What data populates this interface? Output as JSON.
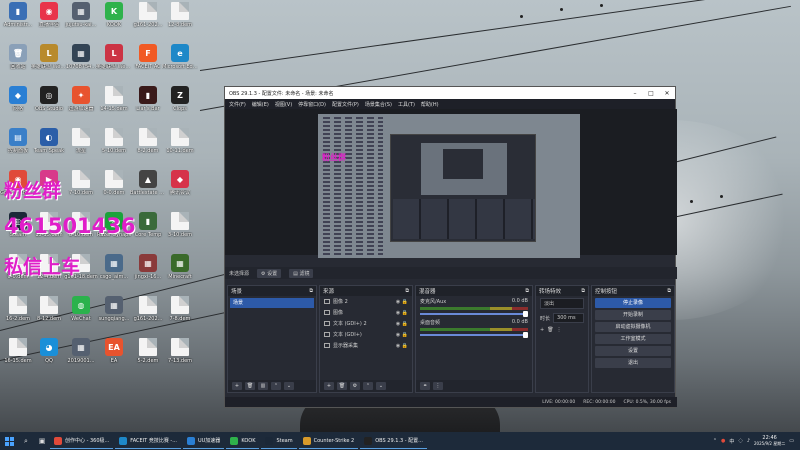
{
  "desktop": {
    "icons": [
      {
        "label": "Administr...",
        "color": "#3a6fb5",
        "glyph": "▮"
      },
      {
        "label": "直播伴侣",
        "color": "#e8344a",
        "glyph": "◉"
      },
      {
        "label": "jujutsu-kai...",
        "color": "#556070",
        "glyph": "▦"
      },
      {
        "label": "KOOK",
        "color": "#2fb24b",
        "glyph": "K"
      },
      {
        "label": "g161-202...",
        "color": "#eeeeee",
        "glyph": ""
      },
      {
        "label": "12-8.dem",
        "color": "#eeeeee",
        "glyph": ""
      },
      {
        "label": "回收站",
        "color": "#8aa0b8",
        "glyph": "🗑"
      },
      {
        "label": "英雄联盟 WeGame版",
        "color": "#b88a2c",
        "glyph": "L"
      },
      {
        "label": "10708754...",
        "color": "#334455",
        "glyph": "▦"
      },
      {
        "label": "英雄联盟 WeGame版",
        "color": "#cc3344",
        "glyph": "L"
      },
      {
        "label": "FACEIT AC",
        "color": "#f15a24",
        "glyph": "F"
      },
      {
        "label": "Microsoft Edge",
        "color": "#1e88c8",
        "glyph": "e"
      },
      {
        "label": "网络",
        "color": "#2a7fd4",
        "glyph": "◆"
      },
      {
        "label": "OBS Studio",
        "color": "#222222",
        "glyph": "◎"
      },
      {
        "label": "迅游加速器",
        "color": "#e8532e",
        "glyph": "✦"
      },
      {
        "label": "14-15.dem",
        "color": "#eeeeee",
        "glyph": ""
      },
      {
        "label": "Liar's Bar",
        "color": "#3a1a1a",
        "glyph": "▮"
      },
      {
        "label": "Clops",
        "color": "#222222",
        "glyph": "Z"
      },
      {
        "label": "控制面板",
        "color": "#3a7fc8",
        "glyph": "▤"
      },
      {
        "label": "Team Speak",
        "color": "#2b5ea8",
        "glyph": "◐"
      },
      {
        "label": "流星",
        "color": "#eeeeee",
        "glyph": ""
      },
      {
        "label": "5-10.dem",
        "color": "#eeeeee",
        "glyph": ""
      },
      {
        "label": "8-2.dem",
        "color": "#eeeeee",
        "glyph": ""
      },
      {
        "label": "10-11.dem",
        "color": "#eeeeee",
        "glyph": ""
      },
      {
        "label": "Google Chrome",
        "color": "#e04a3a",
        "glyph": "◉"
      },
      {
        "label": "uu",
        "color": "#d83a8a",
        "glyph": "▶"
      },
      {
        "label": "7-10.dem",
        "color": "#eeeeee",
        "glyph": ""
      },
      {
        "label": "0-0.dem",
        "color": "#eeeeee",
        "glyph": ""
      },
      {
        "label": "Battlestate Games L...",
        "color": "#444444",
        "glyph": "▲"
      },
      {
        "label": "腾讯会议",
        "color": "#d6334a",
        "glyph": "◆"
      },
      {
        "label": "Steam",
        "color": "#1b2838",
        "glyph": "◎"
      },
      {
        "label": "15-15.dem",
        "color": "#eeeeee",
        "glyph": ""
      },
      {
        "label": "8-10.dem",
        "color": "#eeeeee",
        "glyph": ""
      },
      {
        "label": "Razer Synaps",
        "color": "#1aa33a",
        "glyph": "✳"
      },
      {
        "label": "Core Temp",
        "color": "#3a6a3a",
        "glyph": "▮"
      },
      {
        "label": "3-10.dem",
        "color": "#eeeeee",
        "glyph": ""
      },
      {
        "label": "0-0.dem",
        "color": "#eeeeee",
        "glyph": ""
      },
      {
        "label": "12-4.dem",
        "color": "#eeeeee",
        "glyph": ""
      },
      {
        "label": "g161-18.dem",
        "color": "#eeeeee",
        "glyph": ""
      },
      {
        "label": "csgo_aim...",
        "color": "#4a6a8a",
        "glyph": "▦"
      },
      {
        "label": "jingxi-16...",
        "color": "#8a3a3a",
        "glyph": "▦"
      },
      {
        "label": "Minecraft",
        "color": "#3a6a2a",
        "glyph": "▦"
      },
      {
        "label": "16-2.dem",
        "color": "#eeeeee",
        "glyph": ""
      },
      {
        "label": "8-12.dem",
        "color": "#eeeeee",
        "glyph": ""
      },
      {
        "label": "WeChat",
        "color": "#2bb24c",
        "glyph": "◍"
      },
      {
        "label": "sungqiang...",
        "color": "#556070",
        "glyph": "▦"
      },
      {
        "label": "g161-202...",
        "color": "#eeeeee",
        "glyph": ""
      },
      {
        "label": "7-8.dem",
        "color": "#eeeeee",
        "glyph": ""
      },
      {
        "label": "16-15.dem",
        "color": "#eeeeee",
        "glyph": ""
      },
      {
        "label": "QQ",
        "color": "#1a8fd8",
        "glyph": "◕"
      },
      {
        "label": "2019001...",
        "color": "#556070",
        "glyph": "▦"
      },
      {
        "label": "EA",
        "color": "#e8532e",
        "glyph": "EA"
      },
      {
        "label": "5-2.dem",
        "color": "#eeeeee",
        "glyph": ""
      },
      {
        "label": "7-13.dem",
        "color": "#eeeeee",
        "glyph": ""
      }
    ]
  },
  "overlay": {
    "line1": "粉丝群",
    "line2": "461501436",
    "line3": "私信上车"
  },
  "obs": {
    "title": "OBS 29.1.3 - 配置文件: 未命名 - 场景: 未命名",
    "menu": [
      "文件(F)",
      "编辑(E)",
      "视图(V)",
      "停靠窗口(D)",
      "配置文件(P)",
      "场景集合(S)",
      "工具(T)",
      "帮助(H)"
    ],
    "preview_overlay": "粉丝群",
    "scene_bar": {
      "selected": "未选择源",
      "settings": "设置",
      "filters": "滤镜"
    },
    "scenes": {
      "title": "场景",
      "items": [
        "场景"
      ]
    },
    "sources": {
      "title": "来源",
      "items": [
        "图像 2",
        "图像",
        "文本 (GDI+) 2",
        "文本 (GDI+)",
        "显示器采集"
      ]
    },
    "mixer": {
      "title": "混音器",
      "channels": [
        {
          "name": "麦克风/Aux",
          "db": "0.0 dB"
        },
        {
          "name": "桌面音频",
          "db": "0.0 dB"
        }
      ]
    },
    "transitions": {
      "title": "转场特效",
      "type": "淡出",
      "duration_label": "时长",
      "duration": "300 ms"
    },
    "controls": {
      "title": "控制按钮",
      "buttons": [
        "停止录像",
        "开始录制",
        "启动虚拟摄像机",
        "工作室模式",
        "设置",
        "退出"
      ]
    },
    "status": {
      "live": "LIVE: 00:00:00",
      "rec": "REC: 00:00:00",
      "cpu": "CPU: 0.5%, 30.00 fps"
    }
  },
  "taskbar": {
    "apps": [
      {
        "label": "创作中心 - 360极...",
        "color": "#e04a3a"
      },
      {
        "label": "FACEIT 竞技比赛 -...",
        "color": "#1e88c8"
      },
      {
        "label": "UU加速器",
        "color": "#2a7fd4"
      },
      {
        "label": "KOOK",
        "color": "#2fb24b"
      },
      {
        "label": "Steam",
        "color": "#1b2838"
      },
      {
        "label": "Counter-Strike 2",
        "color": "#d89a2a"
      },
      {
        "label": "OBS 29.1.3 - 配置...",
        "color": "#222222"
      }
    ],
    "time": "22:46",
    "date": "2025/9/2 星期二"
  }
}
